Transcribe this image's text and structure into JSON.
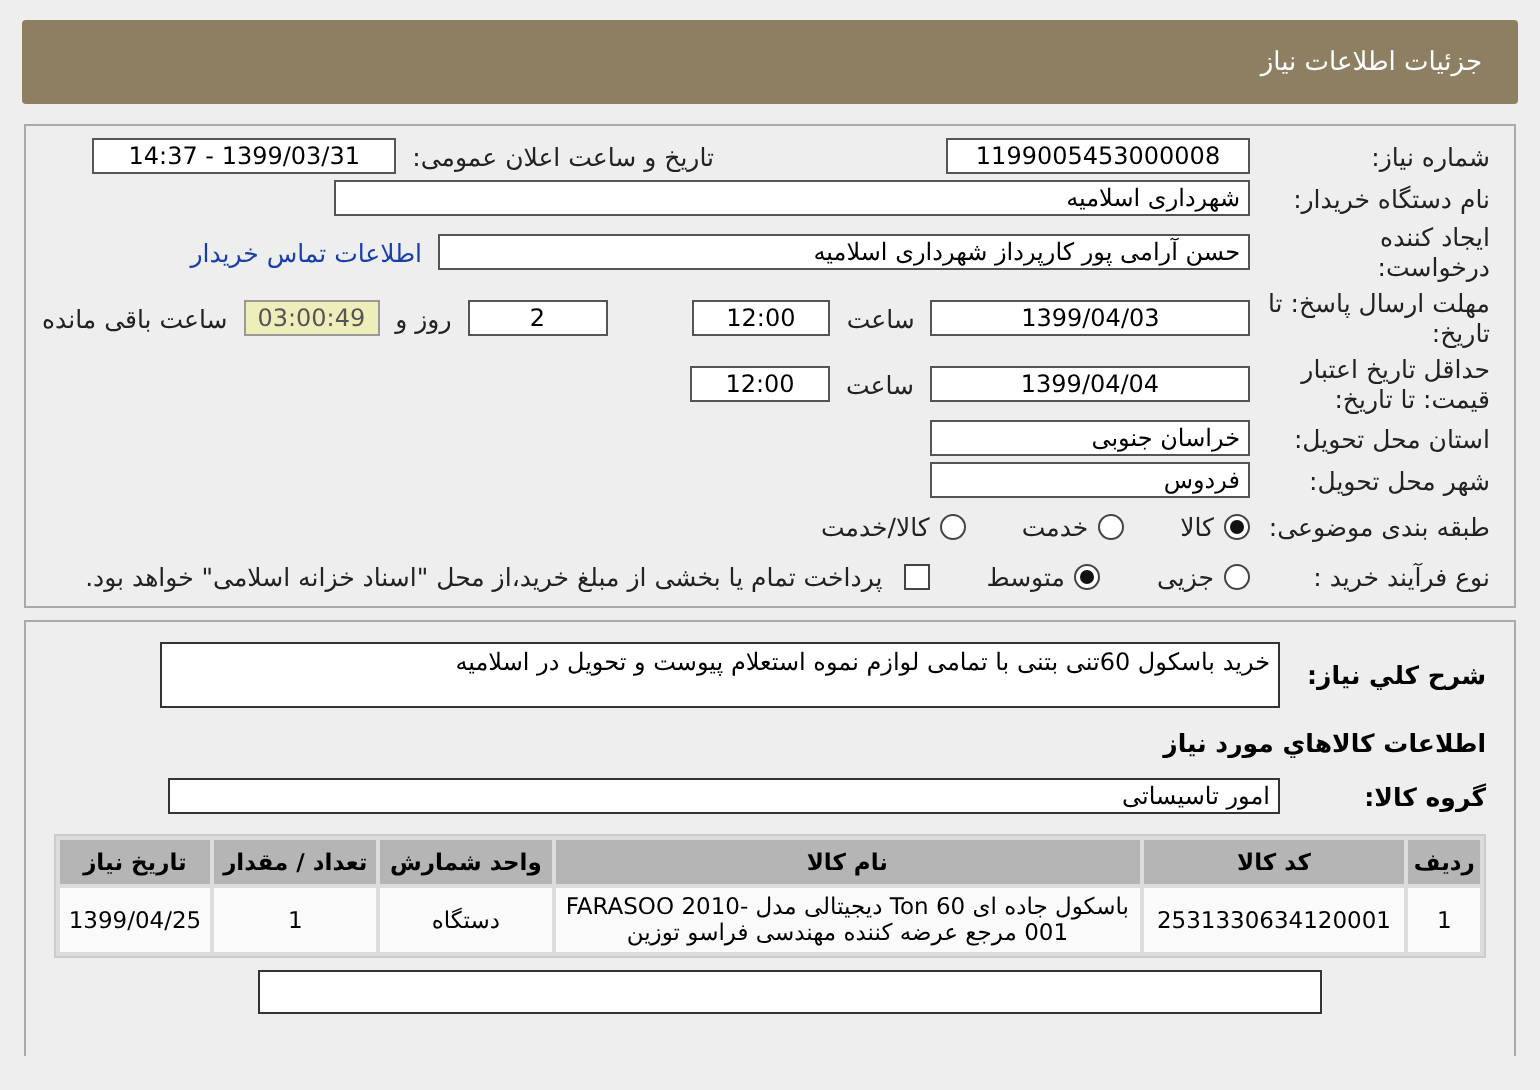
{
  "header": {
    "title": "جزئیات اطلاعات نیاز"
  },
  "need_number": {
    "label": "شماره نیاز:",
    "value": "1199005453000008"
  },
  "announce_date": {
    "label": "تاریخ و ساعت اعلان عمومی:",
    "value": "1399/03/31 - 14:37"
  },
  "buyer": {
    "label": "نام دستگاه خریدار:",
    "value": "شهرداری اسلامیه"
  },
  "creator": {
    "label": "ایجاد کننده درخواست:",
    "value": "حسن آرامی پور کارپرداز شهرداری اسلامیه",
    "link": "اطلاعات تماس خریدار"
  },
  "deadline": {
    "label": "مهلت ارسال پاسخ: تا تاریخ:",
    "date": "1399/04/03",
    "time_label": "ساعت",
    "time": "12:00",
    "days": "2",
    "days_label": "روز و",
    "remaining": "03:00:49",
    "remaining_label": "ساعت باقی مانده"
  },
  "validity": {
    "label": "حداقل تاریخ اعتبار قیمت: تا تاریخ:",
    "date": "1399/04/04",
    "time_label": "ساعت",
    "time": "12:00"
  },
  "province": {
    "label": "استان محل تحویل:",
    "value": "خراسان جنوبی"
  },
  "city": {
    "label": "شهر محل تحویل:",
    "value": "فردوس"
  },
  "category": {
    "label": "طبقه بندی موضوعی:",
    "options": [
      {
        "label": "کالا",
        "selected": true
      },
      {
        "label": "خدمت",
        "selected": false
      },
      {
        "label": "کالا/خدمت",
        "selected": false
      }
    ]
  },
  "process": {
    "label": "نوع فرآیند خرید :",
    "options": [
      {
        "label": "جزیی",
        "selected": false
      },
      {
        "label": "متوسط",
        "selected": true
      }
    ],
    "treasury": {
      "label": "پرداخت تمام یا بخشی از مبلغ خرید،از محل \"اسناد خزانه اسلامی\" خواهد بود.",
      "checked": false
    }
  },
  "description": {
    "label": "شرح کلي نياز:",
    "value": "خرید باسکول 60تنی بتنی با تمامی لوازم نموه استعلام پیوست و تحویل در اسلامیه"
  },
  "goods_heading": "اطلاعات کالاهاي مورد نياز",
  "goods_group": {
    "label": "گروه کالا:",
    "value": "امور تاسیساتی"
  },
  "table": {
    "columns": [
      "ردیف",
      "کد کالا",
      "نام کالا",
      "واحد شمارش",
      "تعداد / مقدار",
      "تاریخ نیاز"
    ],
    "rows": [
      [
        "1",
        "2531330634120001",
        "باسکول جاده ای Ton 60 دیجیتالی مدل FARASOO 2010-001 مرجع عرضه کننده مهندسی فراسو توزین",
        "دستگاه",
        "1",
        "1399/04/25"
      ]
    ]
  }
}
